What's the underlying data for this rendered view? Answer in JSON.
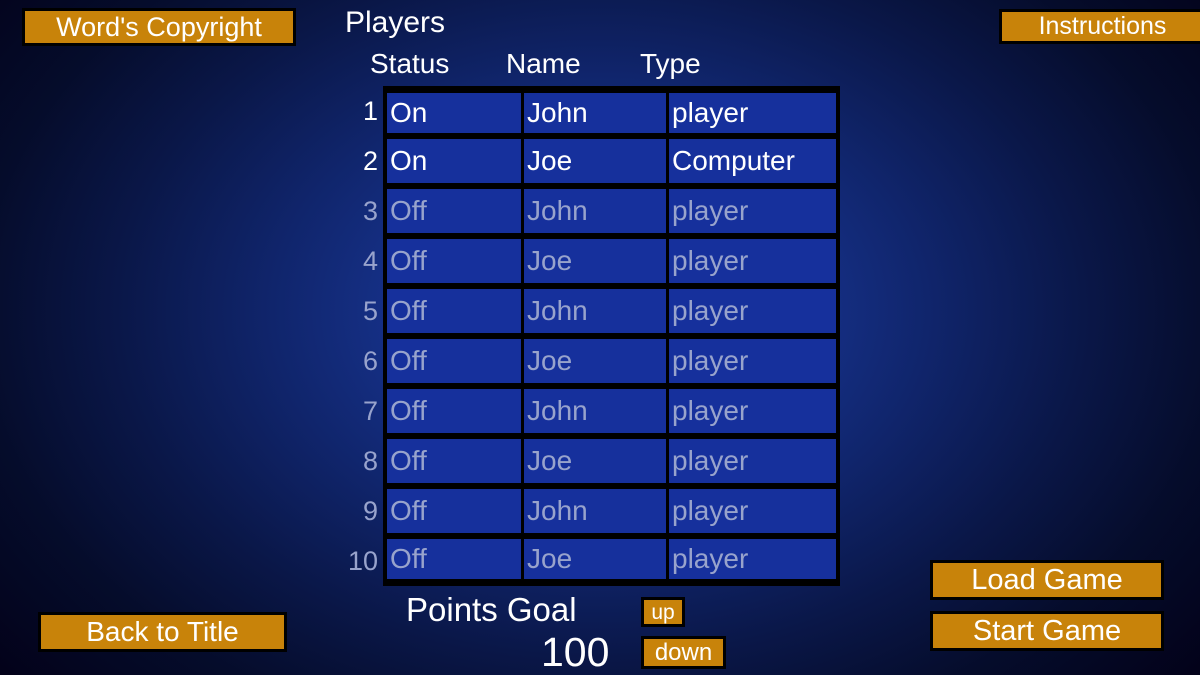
{
  "screen": {
    "title": "Players",
    "accent_color": "#c8830a",
    "cell_color": "#16309c",
    "text_color": "#ffffff",
    "disabled_text_color": "#98a3cc",
    "background_color": "#03021a"
  },
  "buttons": {
    "copyright": "Word's Copyright",
    "instructions": "Instructions",
    "back_to_title": "Back to Title",
    "load_game": "Load Game",
    "start_game": "Start Game",
    "points_up": "up",
    "points_down": "down"
  },
  "table": {
    "headers": {
      "status": "Status",
      "name": "Name",
      "type": "Type"
    },
    "rows": [
      {
        "num": "1",
        "status": "On",
        "name": "John",
        "type": "player",
        "active": true
      },
      {
        "num": "2",
        "status": "On",
        "name": "Joe",
        "type": "Computer",
        "active": true
      },
      {
        "num": "3",
        "status": "Off",
        "name": "John",
        "type": "player",
        "active": false
      },
      {
        "num": "4",
        "status": "Off",
        "name": "Joe",
        "type": "player",
        "active": false
      },
      {
        "num": "5",
        "status": "Off",
        "name": "John",
        "type": "player",
        "active": false
      },
      {
        "num": "6",
        "status": "Off",
        "name": "Joe",
        "type": "player",
        "active": false
      },
      {
        "num": "7",
        "status": "Off",
        "name": "John",
        "type": "player",
        "active": false
      },
      {
        "num": "8",
        "status": "Off",
        "name": "Joe",
        "type": "player",
        "active": false
      },
      {
        "num": "9",
        "status": "Off",
        "name": "John",
        "type": "player",
        "active": false
      },
      {
        "num": "10",
        "status": "Off",
        "name": "Joe",
        "type": "player",
        "active": false
      }
    ]
  },
  "points_goal": {
    "label": "Points Goal",
    "value": "100"
  }
}
